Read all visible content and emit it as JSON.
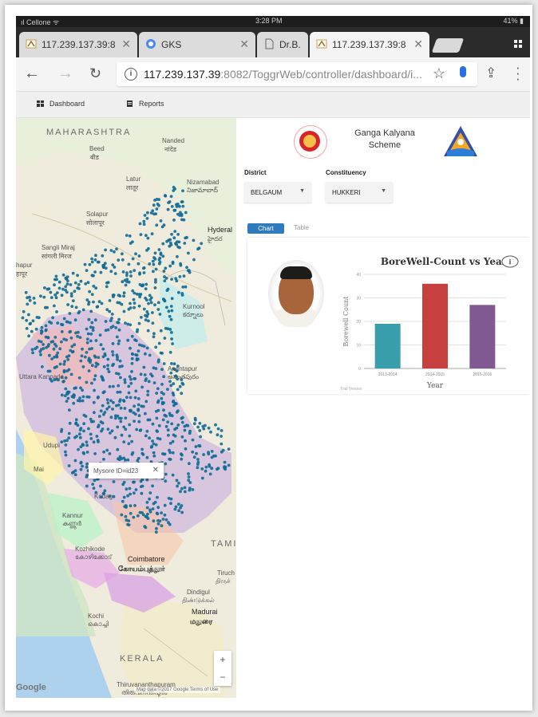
{
  "status": {
    "carrier": "ıl Cellone ᯤ",
    "time": "3:28 PM",
    "battery": "41% ▮"
  },
  "tabs": [
    {
      "title": "117.239.137.39:8",
      "close": "✕"
    },
    {
      "title": "GKS",
      "close": "✕"
    },
    {
      "title": "Dr.B.",
      "close": "✕"
    },
    {
      "title": "117.239.137.39:8",
      "close": "✕"
    }
  ],
  "address": {
    "host": "117.239.137.39",
    "path": ":8082/ToggrWeb/controller/dashboard/i..."
  },
  "nav": {
    "dashboard": "Dashboard",
    "reports": "Reports"
  },
  "map": {
    "labels": {
      "maharashtra": "MAHARASHTRA",
      "nanded": "Nanded",
      "nanded_local": "नांदेड",
      "beed": "Beed",
      "beed_local": "बीड",
      "latur": "Latur",
      "latur_local": "लातूर",
      "nizamabad": "Nizamabad",
      "nizamabad_local": "నిజామాబాద్",
      "solapur": "Solapur",
      "solapur_local": "सोलापूर",
      "hyderabad": "Hyderal",
      "hyderabad_local": "హైదర",
      "sangli": "Sangli Miraj",
      "sangli_local": "सांगली मिरज",
      "kolhapur": "hapur",
      "kolhapur_local": "हापूर",
      "kurnool": "Kurnool",
      "kurnool_local": "కర్నూలు",
      "anantapur": "Anantapur",
      "anantapur_local": "అనంతపురం",
      "uttara_kannada": "Uttara Kannada",
      "udupi": "Udupi",
      "mangaluru": "Mai",
      "kannur": "Kannur",
      "kannur_local": "കണ്ണൂർ",
      "kozhikode": "Kozhikode",
      "kozhikode_local": "കോഴിക്കോട്",
      "coimbatore": "Coimbatore",
      "coimbatore_local": "கோயம்புத்தூர்",
      "tiruchi": "Tiruch",
      "tiruchi_local": "திருச்",
      "dindigul": "Dindigul",
      "dindigul_local": "திண்டுக்கல்",
      "madurai": "Madurai",
      "madurai_local": "மதுரை",
      "kochi": "Kochi",
      "kochi_local": "കൊച്ചി",
      "kerala": "KERALA",
      "tamil": "TAMI",
      "thiruvananthapuram": "Thiruvananthapuram",
      "thiruvananthapuram_local": "തിരുവനന്തപുരം",
      "kodagu": "Kodag"
    },
    "popup": {
      "text": "Mysore ID=id23",
      "close": "✕"
    },
    "zoom_in": "+",
    "zoom_out": "−",
    "google": "Google",
    "attribution": "Map data ©2017 Google   Terms of Use"
  },
  "header": {
    "scheme_title": "Ganga Kalyana Scheme"
  },
  "filters": {
    "district_label": "District",
    "district_value": "BELGAUM",
    "constituency_label": "Constituency",
    "constituency_value": "HUKKERI"
  },
  "view_tabs": {
    "chart": "Chart",
    "table": "Table"
  },
  "colors": {
    "primary": "#2f7bbf",
    "dots": "#0e6a96",
    "bar1": "#3a9fad",
    "bar2": "#c6403f",
    "bar3": "#805992"
  },
  "chart_data": {
    "type": "bar",
    "title": "BoreWell-Count vs Year",
    "xlabel": "Year",
    "ylabel": "Borewell Count",
    "categories": [
      "2013-2014",
      "2014-2015",
      "2015-2016"
    ],
    "values": [
      19,
      36,
      27
    ],
    "ylim": [
      0,
      40
    ],
    "yticks": [
      0,
      10,
      20,
      30,
      40
    ],
    "grid": true,
    "footnote": "Trial Version",
    "info_icon": "i"
  }
}
